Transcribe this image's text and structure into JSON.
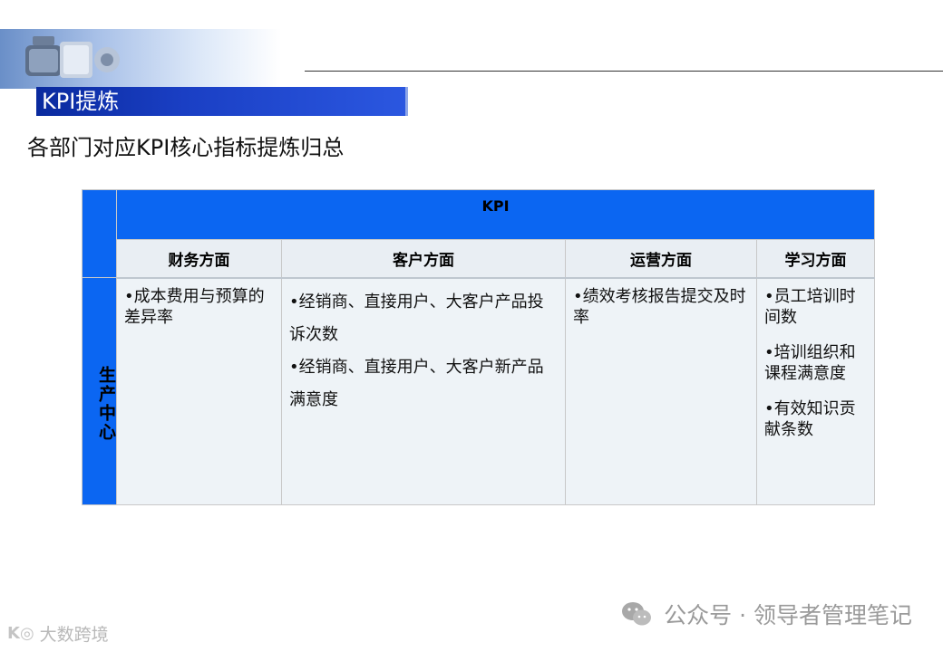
{
  "header": {
    "title": "KPI提炼",
    "subtitle": "各部门对应KPI核心指标提炼归总"
  },
  "table": {
    "kpi_header": "KPI",
    "columns": [
      "财务方面",
      "客户方面",
      "运营方面",
      "学习方面"
    ],
    "row_label": "生产中心",
    "cells": {
      "finance": [
        "•成本费用与预算的差异率"
      ],
      "customer": [
        "•经销商、直接用户、大客户产品投诉次数",
        "•经销商、直接用户、大客户新产品满意度"
      ],
      "operations": [
        "•绩效考核报告提交及时率"
      ],
      "learning": [
        "•员工培训时间数",
        "•培训组织和课程满意度",
        "•有效知识贡献条数"
      ]
    }
  },
  "footer": {
    "watermark": "公众号 · 领导者管理笔记",
    "corner_logo": "大数跨境"
  },
  "colors": {
    "title_bar": "#1a3fc4",
    "table_blue": "#0b66f2",
    "cell_bg": "#eef3f7"
  }
}
